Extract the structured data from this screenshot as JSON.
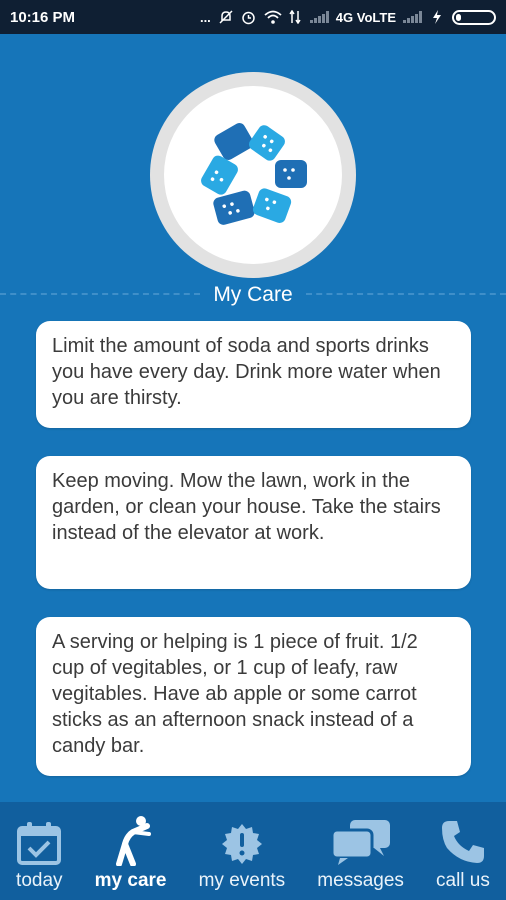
{
  "status_bar": {
    "time": "10:16 PM",
    "dots": "...",
    "network": "4G VoLTE",
    "icons": [
      "mute-icon",
      "alarm-icon",
      "wifi-icon",
      "data-arrows-icon",
      "signal-icon",
      "battery-icon"
    ]
  },
  "header": {
    "title": "My Care",
    "logo": "bandage-logo-icon"
  },
  "cards": [
    {
      "text": "Limit the amount of soda and sports drinks you have every day. Drink more water when you are thirsty."
    },
    {
      "text": "Keep moving. Mow the lawn, work in the garden, or clean your house. Take the stairs instead of the elevator at work."
    },
    {
      "text": "A serving or helping is 1 piece of fruit. 1/2 cup of vegitables, or 1 cup of leafy, raw vegitables. Have ab apple or some carrot sticks as an afternoon snack instead of a candy bar."
    }
  ],
  "nav": {
    "items": [
      {
        "label": "today",
        "icon": "calendar-check-icon"
      },
      {
        "label": "my care",
        "icon": "stretching-person-icon",
        "active": true
      },
      {
        "label": "my events",
        "icon": "alert-badge-icon"
      },
      {
        "label": "messages",
        "icon": "chat-bubbles-icon"
      },
      {
        "label": "call us",
        "icon": "phone-icon"
      }
    ]
  },
  "colors": {
    "background": "#1675b9",
    "status_bar": "#0f1f33",
    "nav_bar": "#115f9e",
    "logo_dark": "#1f6fb5",
    "logo_light": "#2aa9e3",
    "nav_icon": "#9cc4e4"
  }
}
